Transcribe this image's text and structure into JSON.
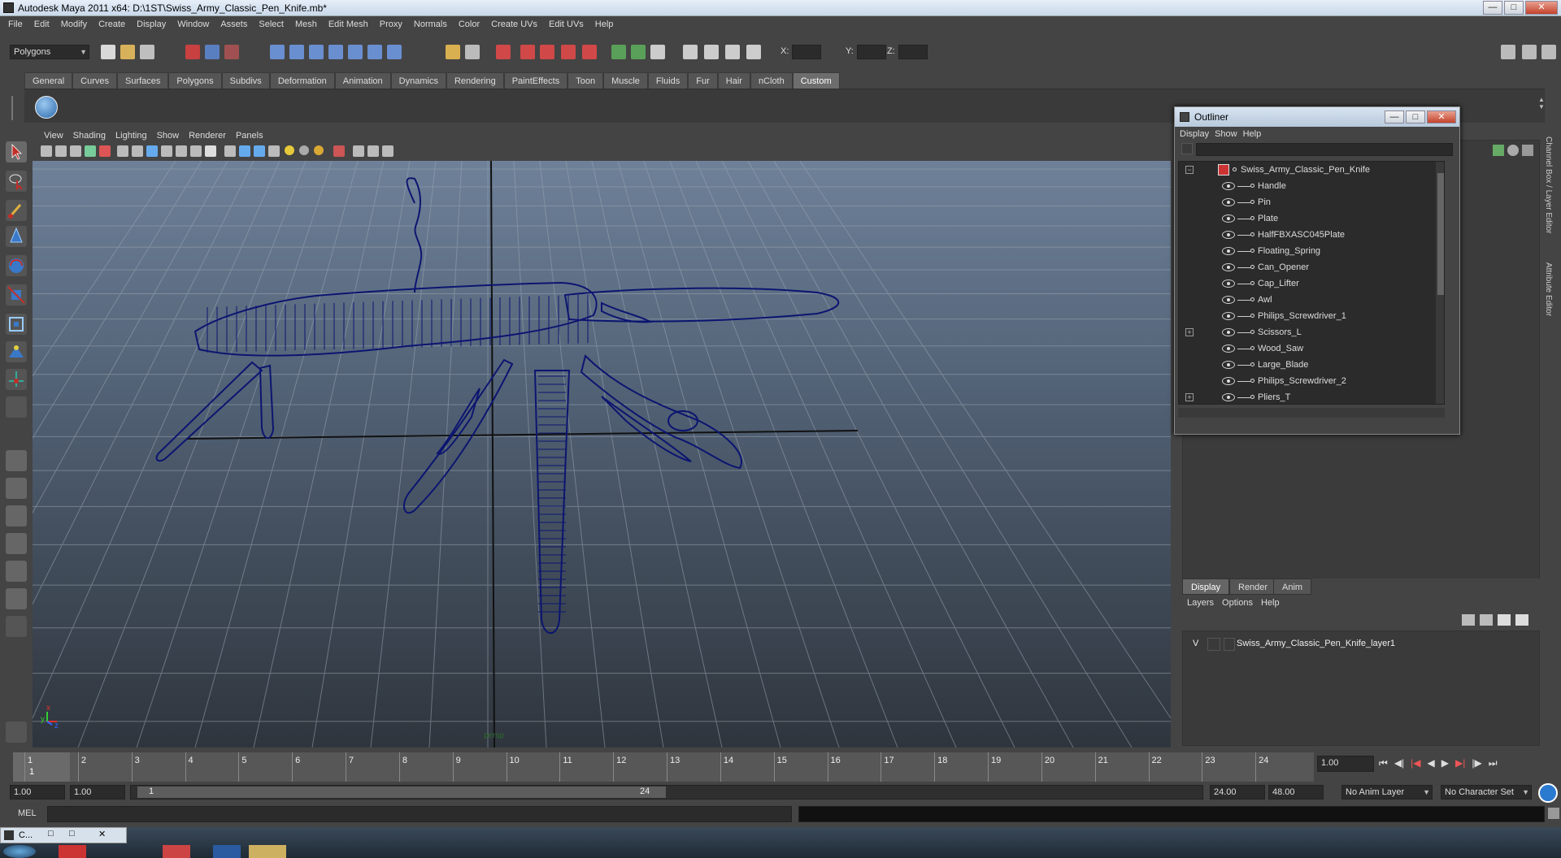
{
  "window": {
    "title": "Autodesk Maya 2011 x64: D:\\1ST\\Swiss_Army_Classic_Pen_Knife.mb*",
    "minimize_icon": "minimize-icon",
    "maximize_icon": "maximize-icon",
    "close_icon": "close-icon"
  },
  "menubar": [
    "File",
    "Edit",
    "Modify",
    "Create",
    "Display",
    "Window",
    "Assets",
    "Select",
    "Mesh",
    "Edit Mesh",
    "Proxy",
    "Normals",
    "Color",
    "Create UVs",
    "Edit UVs",
    "Help"
  ],
  "status_line": {
    "menu_set": "Polygons",
    "x_label": "X:",
    "y_label": "Y:",
    "z_label": "Z:"
  },
  "shelf_tabs": [
    "General",
    "Curves",
    "Surfaces",
    "Polygons",
    "Subdivs",
    "Deformation",
    "Animation",
    "Dynamics",
    "Rendering",
    "PaintEffects",
    "Toon",
    "Muscle",
    "Fluids",
    "Fur",
    "Hair",
    "nCloth",
    "Custom"
  ],
  "shelf_active": "Custom",
  "panel_menu": [
    "View",
    "Shading",
    "Lighting",
    "Show",
    "Renderer",
    "Panels"
  ],
  "viewport": {
    "axis_x": "x",
    "axis_y": "y",
    "axis_z": "z",
    "camera_label": "persp"
  },
  "outliner": {
    "title": "Outliner",
    "menu": [
      "Display",
      "Show",
      "Help"
    ],
    "root": "Swiss_Army_Classic_Pen_Knife",
    "items": [
      "Handle",
      "Pin",
      "Plate",
      "HalfFBXASC045Plate",
      "Floating_Spring",
      "Can_Opener",
      "Cap_Lifter",
      "Awl",
      "Philips_Screwdriver_1",
      "Scissors_L",
      "Wood_Saw",
      "Large_Blade",
      "Philips_Screwdriver_2",
      "Pliers_T"
    ],
    "expandable": [
      "Scissors_L",
      "Pliers_T"
    ]
  },
  "side_tabs": [
    "Channel Box / Layer Editor",
    "Attribute Editor"
  ],
  "layer_editor": {
    "tabs": [
      "Display",
      "Render",
      "Anim"
    ],
    "active_tab": "Display",
    "menu": [
      "Layers",
      "Options",
      "Help"
    ],
    "layer_visibility": "V",
    "layer_name": "Swiss_Army_Classic_Pen_Knife_layer1"
  },
  "time_slider": {
    "ticks": [
      "1",
      "2",
      "3",
      "4",
      "5",
      "6",
      "7",
      "8",
      "9",
      "10",
      "11",
      "12",
      "13",
      "14",
      "15",
      "16",
      "17",
      "18",
      "19",
      "20",
      "21",
      "22",
      "23",
      "24"
    ],
    "current_frame": "1",
    "current_time_field": "1.00"
  },
  "range_slider": {
    "start_time": "1.00",
    "playback_start": "1.00",
    "range_start": "1",
    "range_end": "24",
    "playback_end": "24.00",
    "end_time": "48.00",
    "anim_layer": "No Anim Layer",
    "character_set": "No Character Set"
  },
  "command_line": {
    "label": "MEL"
  },
  "taskbar": {
    "minimized_window": "C..."
  },
  "colors": {
    "wireframe": "#0c1570",
    "viewport_top": "#6e8199",
    "viewport_bottom": "#2f353d",
    "ui_bg": "#444444"
  }
}
